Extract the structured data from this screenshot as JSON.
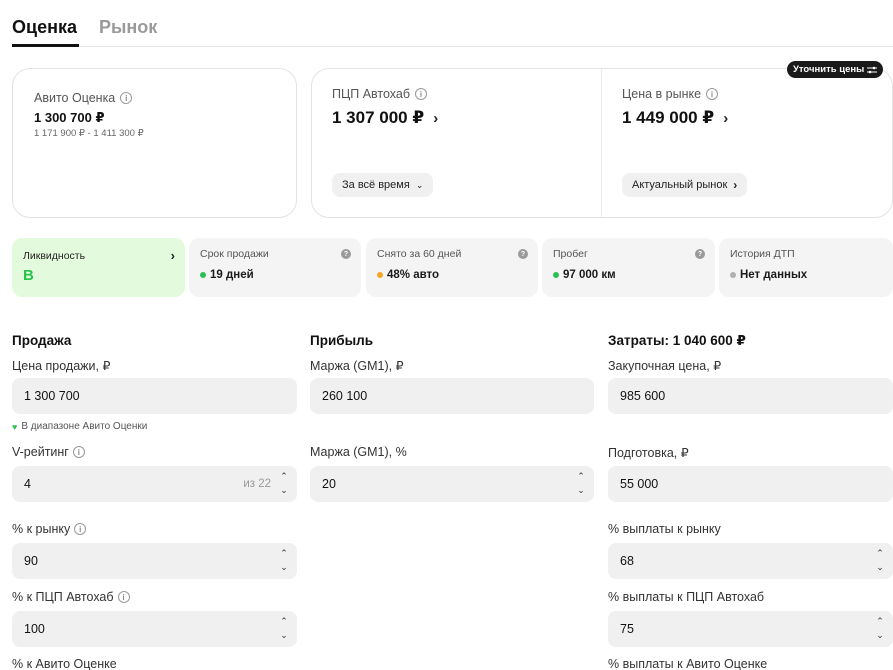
{
  "tabs": [
    "Оценка",
    "Рынок"
  ],
  "refine_button": "Уточнить цены",
  "cards": {
    "avito": {
      "label": "Авито Оценка",
      "value": "1 300 700 ₽",
      "range": "1 171 900 ₽ - 1 411 300 ₽"
    },
    "pcp": {
      "label": "ПЦП Автохаб",
      "value": "1 307 000 ₽",
      "pill": "За всё время"
    },
    "market": {
      "label": "Цена в рынке",
      "value": "1 449 000 ₽",
      "pill": "Актуальный рынок"
    }
  },
  "metrics": [
    {
      "label": "Ликвидность",
      "value": "B"
    },
    {
      "label": "Срок продажи",
      "value": "19 дней",
      "dot_color": "#2fbf55"
    },
    {
      "label": "Снято за 60 дней",
      "value": "48% авто",
      "dot_color": "#f5a623"
    },
    {
      "label": "Пробег",
      "value": "97 000 км",
      "dot_color": "#2fbf55"
    },
    {
      "label": "История ДТП",
      "value": "Нет данных",
      "dot_color": "#b0b0b0"
    }
  ],
  "sale": {
    "title": "Продажа",
    "price_label": "Цена продажи, ₽",
    "price_value": "1 300 700",
    "hint": "В диапазоне Авито Оценки",
    "vrating_label": "V-рейтинг",
    "vrating_value": "4",
    "vrating_suffix": "из 22",
    "pct_market_label": "% к рынку",
    "pct_market_value": "90",
    "pct_pcp_label": "% к ПЦП Автохаб",
    "pct_pcp_value": "100",
    "pct_avito_label": "% к Авито Оценке"
  },
  "profit": {
    "title": "Прибыль",
    "margin_rub_label": "Маржа (GM1), ₽",
    "margin_rub_value": "260 100",
    "margin_pct_label": "Маржа (GM1), %",
    "margin_pct_value": "20"
  },
  "costs": {
    "title": "Затраты: 1 040 600 ₽",
    "purchase_label": "Закупочная цена, ₽",
    "purchase_value": "985 600",
    "prep_label": "Подготовка, ₽",
    "prep_value": "55 000",
    "pay_market_label": "% выплаты к рынку",
    "pay_market_value": "68",
    "pay_pcp_label": "% выплаты к ПЦП Автохаб",
    "pay_pcp_value": "75",
    "pay_avito_label": "% выплаты к Авито Оценке"
  }
}
